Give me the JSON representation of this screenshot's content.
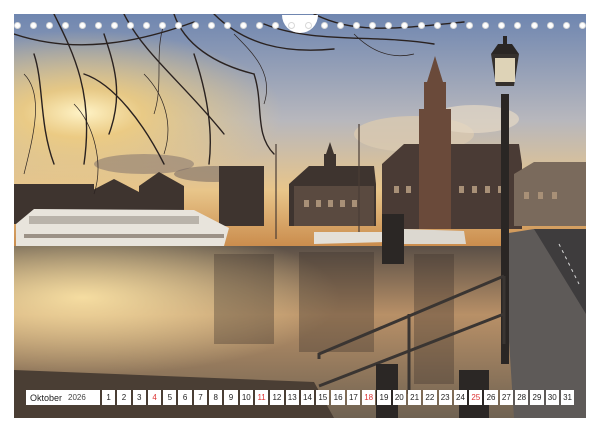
{
  "calendar": {
    "month": "Oktober",
    "year": "2026",
    "days": [
      {
        "n": "1",
        "sun": false
      },
      {
        "n": "2",
        "sun": false
      },
      {
        "n": "3",
        "sun": false
      },
      {
        "n": "4",
        "sun": true
      },
      {
        "n": "5",
        "sun": false
      },
      {
        "n": "6",
        "sun": false
      },
      {
        "n": "7",
        "sun": false
      },
      {
        "n": "8",
        "sun": false
      },
      {
        "n": "9",
        "sun": false
      },
      {
        "n": "10",
        "sun": false
      },
      {
        "n": "11",
        "sun": true
      },
      {
        "n": "12",
        "sun": false
      },
      {
        "n": "13",
        "sun": false
      },
      {
        "n": "14",
        "sun": false
      },
      {
        "n": "15",
        "sun": false
      },
      {
        "n": "16",
        "sun": false
      },
      {
        "n": "17",
        "sun": false
      },
      {
        "n": "18",
        "sun": true
      },
      {
        "n": "19",
        "sun": false
      },
      {
        "n": "20",
        "sun": false
      },
      {
        "n": "21",
        "sun": false
      },
      {
        "n": "22",
        "sun": false
      },
      {
        "n": "23",
        "sun": false
      },
      {
        "n": "24",
        "sun": false
      },
      {
        "n": "25",
        "sun": true
      },
      {
        "n": "26",
        "sun": false
      },
      {
        "n": "27",
        "sun": false
      },
      {
        "n": "28",
        "sun": false
      },
      {
        "n": "29",
        "sun": false
      },
      {
        "n": "30",
        "sun": false
      },
      {
        "n": "31",
        "sun": false
      }
    ]
  },
  "colors": {
    "sky_top": "#7f93b8",
    "sky_glow": "#f4c36a",
    "water": "#8a7560",
    "sunday": "#dd3333"
  },
  "binding": {
    "ring_count": 36
  }
}
